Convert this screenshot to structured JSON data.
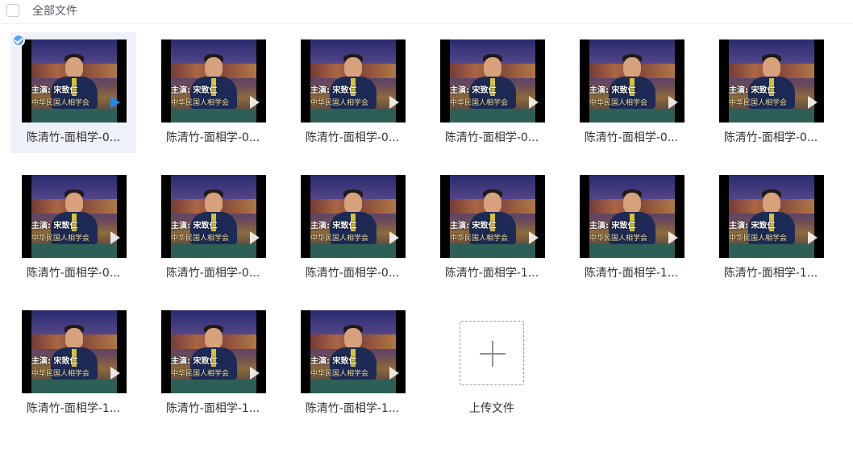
{
  "header": {
    "title": "全部文件"
  },
  "files": [
    {
      "name": "陈清竹-面相学-0...",
      "selected": true
    },
    {
      "name": "陈清竹-面相学-0...",
      "selected": false
    },
    {
      "name": "陈清竹-面相学-0...",
      "selected": false
    },
    {
      "name": "陈清竹-面相学-0...",
      "selected": false
    },
    {
      "name": "陈清竹-面相学-0...",
      "selected": false
    },
    {
      "name": "陈清竹-面相学-0...",
      "selected": false
    },
    {
      "name": "陈清竹-面相学-0...",
      "selected": false
    },
    {
      "name": "陈清竹-面相学-0...",
      "selected": false
    },
    {
      "name": "陈清竹-面相学-0...",
      "selected": false
    },
    {
      "name": "陈清竹-面相学-1...",
      "selected": false
    },
    {
      "name": "陈清竹-面相学-1...",
      "selected": false
    },
    {
      "name": "陈清竹-面相学-1...",
      "selected": false
    },
    {
      "name": "陈清竹-面相学-1...",
      "selected": false
    },
    {
      "name": "陈清竹-面相学-1...",
      "selected": false
    },
    {
      "name": "陈清竹-面相学-1...",
      "selected": false
    }
  ],
  "thumbnail_text": {
    "caption": "主演: 宋致仁",
    "subcaption": "中华民国人相学会"
  },
  "upload": {
    "label": "上传文件"
  },
  "colors": {
    "accent": "#1e88e5",
    "check": "#5aa0f2",
    "selected_bg": "#eef1f8"
  }
}
